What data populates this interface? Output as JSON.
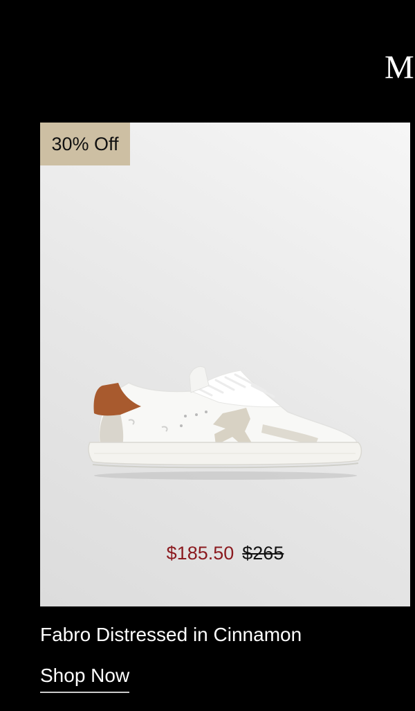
{
  "header": {
    "brand_partial": "M"
  },
  "product": {
    "badge": "30% Off",
    "image_alt": "White distressed leather low-top sneaker with cinnamon brown heel tab",
    "sale_price": "$185.50",
    "original_price": "$265",
    "name": "Fabro Distressed in Cinnamon",
    "cta_label": "Shop Now"
  },
  "colors": {
    "background": "#000000",
    "badge": "#cdbfa3",
    "sale_price": "#8b1a1f",
    "heel_tab": "#a85a2e"
  }
}
